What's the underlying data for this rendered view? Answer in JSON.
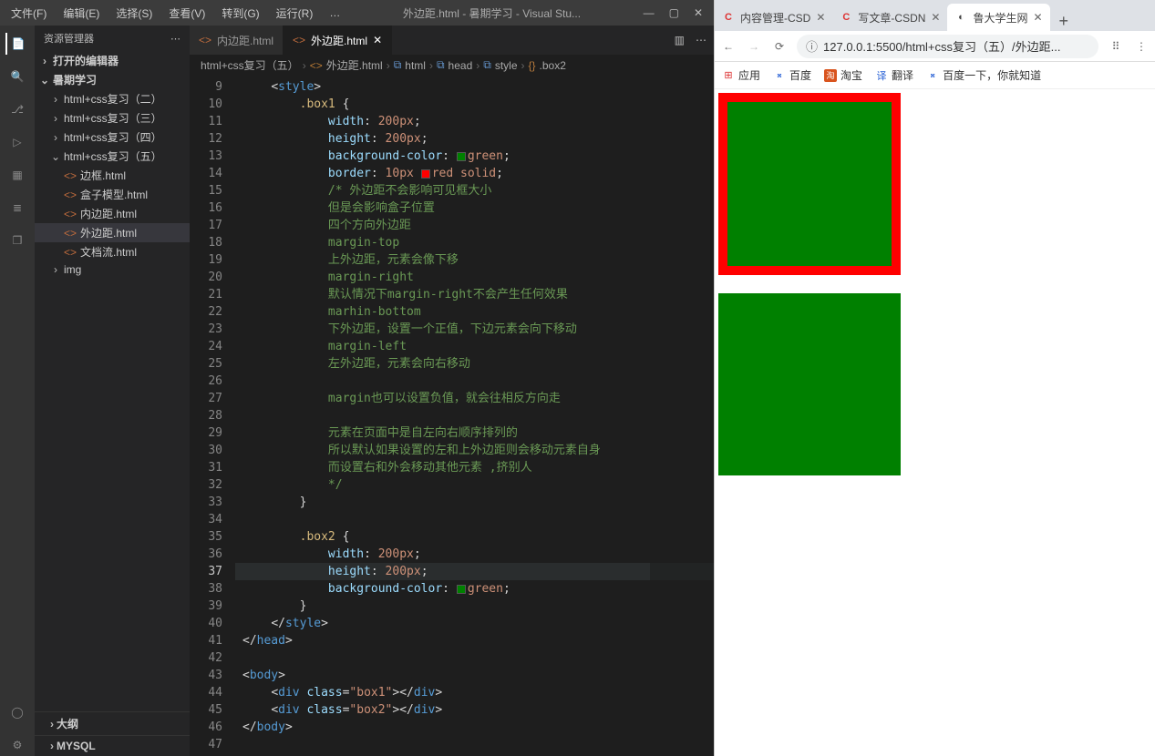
{
  "menubar": {
    "items": [
      "文件(F)",
      "编辑(E)",
      "选择(S)",
      "查看(V)",
      "转到(G)",
      "运行(R)",
      "…"
    ],
    "title": "外边距.html - 暑期学习 - Visual Stu..."
  },
  "sidebar": {
    "header": "资源管理器",
    "open_editors": "打开的编辑器",
    "root": "暑期学习",
    "folders": [
      "html+css复习（二）",
      "html+css复习（三）",
      "html+css复习（四）",
      "html+css复习（五）"
    ],
    "files": [
      "边框.html",
      "盒子模型.html",
      "内边距.html",
      "外边距.html",
      "文档流.html"
    ],
    "img_folder": "img",
    "footer": [
      "大纲",
      "MYSQL"
    ]
  },
  "tabs": [
    {
      "label": "内边距.html",
      "active": false
    },
    {
      "label": "外边距.html",
      "active": true
    }
  ],
  "breadcrumb": [
    "html+css复习（五）",
    "外边距.html",
    "html",
    "head",
    "style",
    ".box2"
  ],
  "gutter": {
    "start": 9,
    "end": 47,
    "current": 37
  },
  "code_lines": [
    {
      "i": 9,
      "html": "    <span class='tok-pun'>&lt;</span><span class='tok-tag'>style</span><span class='tok-pun'>&gt;</span>"
    },
    {
      "i": 10,
      "html": "        <span class='tok-sel'>.box1</span> <span class='tok-pun'>{</span>"
    },
    {
      "i": 11,
      "html": "            <span class='tok-prop'>width</span><span class='tok-pun'>:</span> <span class='tok-val'>200px</span><span class='tok-pun'>;</span>"
    },
    {
      "i": 12,
      "html": "            <span class='tok-prop'>height</span><span class='tok-pun'>:</span> <span class='tok-val'>200px</span><span class='tok-pun'>;</span>"
    },
    {
      "i": 13,
      "html": "            <span class='tok-prop'>background-color</span><span class='tok-pun'>:</span> <span class='colbox col-green'></span><span class='tok-val'>green</span><span class='tok-pun'>;</span>"
    },
    {
      "i": 14,
      "html": "            <span class='tok-prop'>border</span><span class='tok-pun'>:</span> <span class='tok-val'>10px</span> <span class='colbox col-red'></span><span class='tok-val'>red solid</span><span class='tok-pun'>;</span>"
    },
    {
      "i": 15,
      "html": "            <span class='tok-cmt'>/* 外边距不会影响可见框大小</span>"
    },
    {
      "i": 16,
      "html": "            <span class='tok-cmt'>但是会影响盒子位置</span>"
    },
    {
      "i": 17,
      "html": "            <span class='tok-cmt'>四个方向外边距</span>"
    },
    {
      "i": 18,
      "html": "            <span class='tok-cmt'>margin-top</span>"
    },
    {
      "i": 19,
      "html": "            <span class='tok-cmt'>上外边距，元素会像下移</span>"
    },
    {
      "i": 20,
      "html": "            <span class='tok-cmt'>margin-right</span>"
    },
    {
      "i": 21,
      "html": "            <span class='tok-cmt'>默认情况下margin-right不会产生任何效果</span>"
    },
    {
      "i": 22,
      "html": "            <span class='tok-cmt'>marhin-bottom</span>"
    },
    {
      "i": 23,
      "html": "            <span class='tok-cmt'>下外边距，设置一个正值，下边元素会向下移动</span>"
    },
    {
      "i": 24,
      "html": "            <span class='tok-cmt'>margin-left</span>"
    },
    {
      "i": 25,
      "html": "            <span class='tok-cmt'>左外边距，元素会向右移动</span>"
    },
    {
      "i": 26,
      "html": ""
    },
    {
      "i": 27,
      "html": "            <span class='tok-cmt'>margin也可以设置负值，就会往相反方向走</span>"
    },
    {
      "i": 28,
      "html": ""
    },
    {
      "i": 29,
      "html": "            <span class='tok-cmt'>元素在页面中是自左向右顺序排列的</span>"
    },
    {
      "i": 30,
      "html": "            <span class='tok-cmt'>所以默认如果设置的左和上外边距则会移动元素自身</span>"
    },
    {
      "i": 31,
      "html": "            <span class='tok-cmt'>而设置右和外会移动其他元素 ,挤别人</span>"
    },
    {
      "i": 32,
      "html": "            <span class='tok-cmt'>*/</span>"
    },
    {
      "i": 33,
      "html": "        <span class='tok-pun'>}</span>"
    },
    {
      "i": 34,
      "html": ""
    },
    {
      "i": 35,
      "html": "        <span class='tok-sel'>.box2</span> <span class='tok-pun'>{</span>"
    },
    {
      "i": 36,
      "html": "            <span class='tok-prop'>width</span><span class='tok-pun'>:</span> <span class='tok-val'>200px</span><span class='tok-pun'>;</span>"
    },
    {
      "i": 37,
      "html": "            <span class='tok-prop'>height</span><span class='tok-pun'>:</span> <span class='tok-val'>200px</span><span class='tok-pun'>;</span>"
    },
    {
      "i": 38,
      "html": "            <span class='tok-prop'>background-color</span><span class='tok-pun'>:</span> <span class='colbox col-green'></span><span class='tok-val'>green</span><span class='tok-pun'>;</span>"
    },
    {
      "i": 39,
      "html": "        <span class='tok-pun'>}</span>"
    },
    {
      "i": 40,
      "html": "    <span class='tok-pun'>&lt;/</span><span class='tok-tag'>style</span><span class='tok-pun'>&gt;</span>"
    },
    {
      "i": 41,
      "html": "<span class='tok-pun'>&lt;/</span><span class='tok-tag'>head</span><span class='tok-pun'>&gt;</span>"
    },
    {
      "i": 42,
      "html": ""
    },
    {
      "i": 43,
      "html": "<span class='tok-pun'>&lt;</span><span class='tok-tag'>body</span><span class='tok-pun'>&gt;</span>"
    },
    {
      "i": 44,
      "html": "    <span class='tok-pun'>&lt;</span><span class='tok-tag'>div</span> <span class='tok-attr'>class</span><span class='tok-pun'>=</span><span class='tok-str'>\"box1\"</span><span class='tok-pun'>&gt;&lt;/</span><span class='tok-tag'>div</span><span class='tok-pun'>&gt;</span>"
    },
    {
      "i": 45,
      "html": "    <span class='tok-pun'>&lt;</span><span class='tok-tag'>div</span> <span class='tok-attr'>class</span><span class='tok-pun'>=</span><span class='tok-str'>\"box2\"</span><span class='tok-pun'>&gt;&lt;/</span><span class='tok-tag'>div</span><span class='tok-pun'>&gt;</span>"
    },
    {
      "i": 46,
      "html": "<span class='tok-pun'>&lt;/</span><span class='tok-tag'>body</span><span class='tok-pun'>&gt;</span>"
    },
    {
      "i": 47,
      "html": ""
    }
  ],
  "browser": {
    "tabs": [
      {
        "fav": "C",
        "favcolor": "#d33",
        "label": "内容管理-CSD"
      },
      {
        "fav": "C",
        "favcolor": "#d33",
        "label": "写文章-CSDN"
      },
      {
        "fav": "◐",
        "favcolor": "#666",
        "label": "鲁大学生网",
        "active": true
      }
    ],
    "url": "127.0.0.1:5500/html+css复习（五）/外边距...",
    "bookmarks": [
      {
        "icon": "grid",
        "label": "应用"
      },
      {
        "icon": "baidu",
        "label": "百度"
      },
      {
        "icon": "taobao",
        "label": "淘宝",
        "text": "淘"
      },
      {
        "icon": "fy",
        "label": "翻译"
      },
      {
        "icon": "baidu",
        "label": "百度一下，你就知道"
      }
    ]
  }
}
